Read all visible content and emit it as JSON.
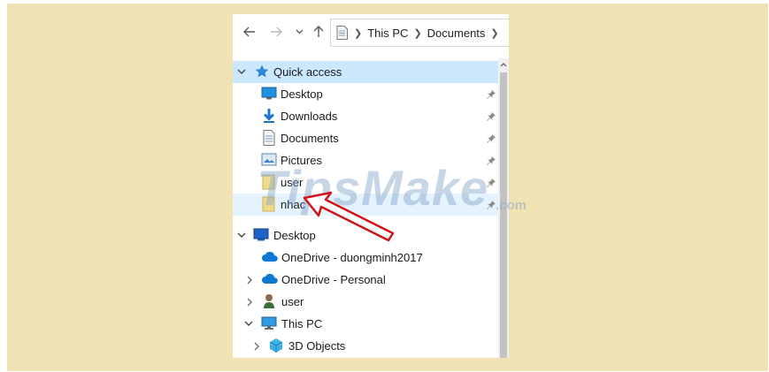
{
  "address": {
    "segments": [
      "This PC",
      "Documents"
    ]
  },
  "quick_access": {
    "label": "Quick access",
    "items": [
      {
        "label": "Desktop"
      },
      {
        "label": "Downloads"
      },
      {
        "label": "Documents"
      },
      {
        "label": "Pictures"
      },
      {
        "label": "user"
      },
      {
        "label": "nhac"
      }
    ]
  },
  "desktop": {
    "label": "Desktop",
    "items": [
      {
        "label": "OneDrive - duongminh2017"
      },
      {
        "label": "OneDrive - Personal"
      },
      {
        "label": "user"
      },
      {
        "label": "This PC"
      }
    ]
  },
  "this_pc": {
    "items": [
      {
        "label": "3D Objects"
      }
    ]
  },
  "watermark": {
    "text": "TipsMake",
    "suffix": ".com"
  },
  "colors": {
    "backdrop": "#f0e2b2",
    "selection": "#cce8ff",
    "hover": "#e5f3ff",
    "arrow": "#d0141a",
    "folder": "#e8d68c"
  }
}
